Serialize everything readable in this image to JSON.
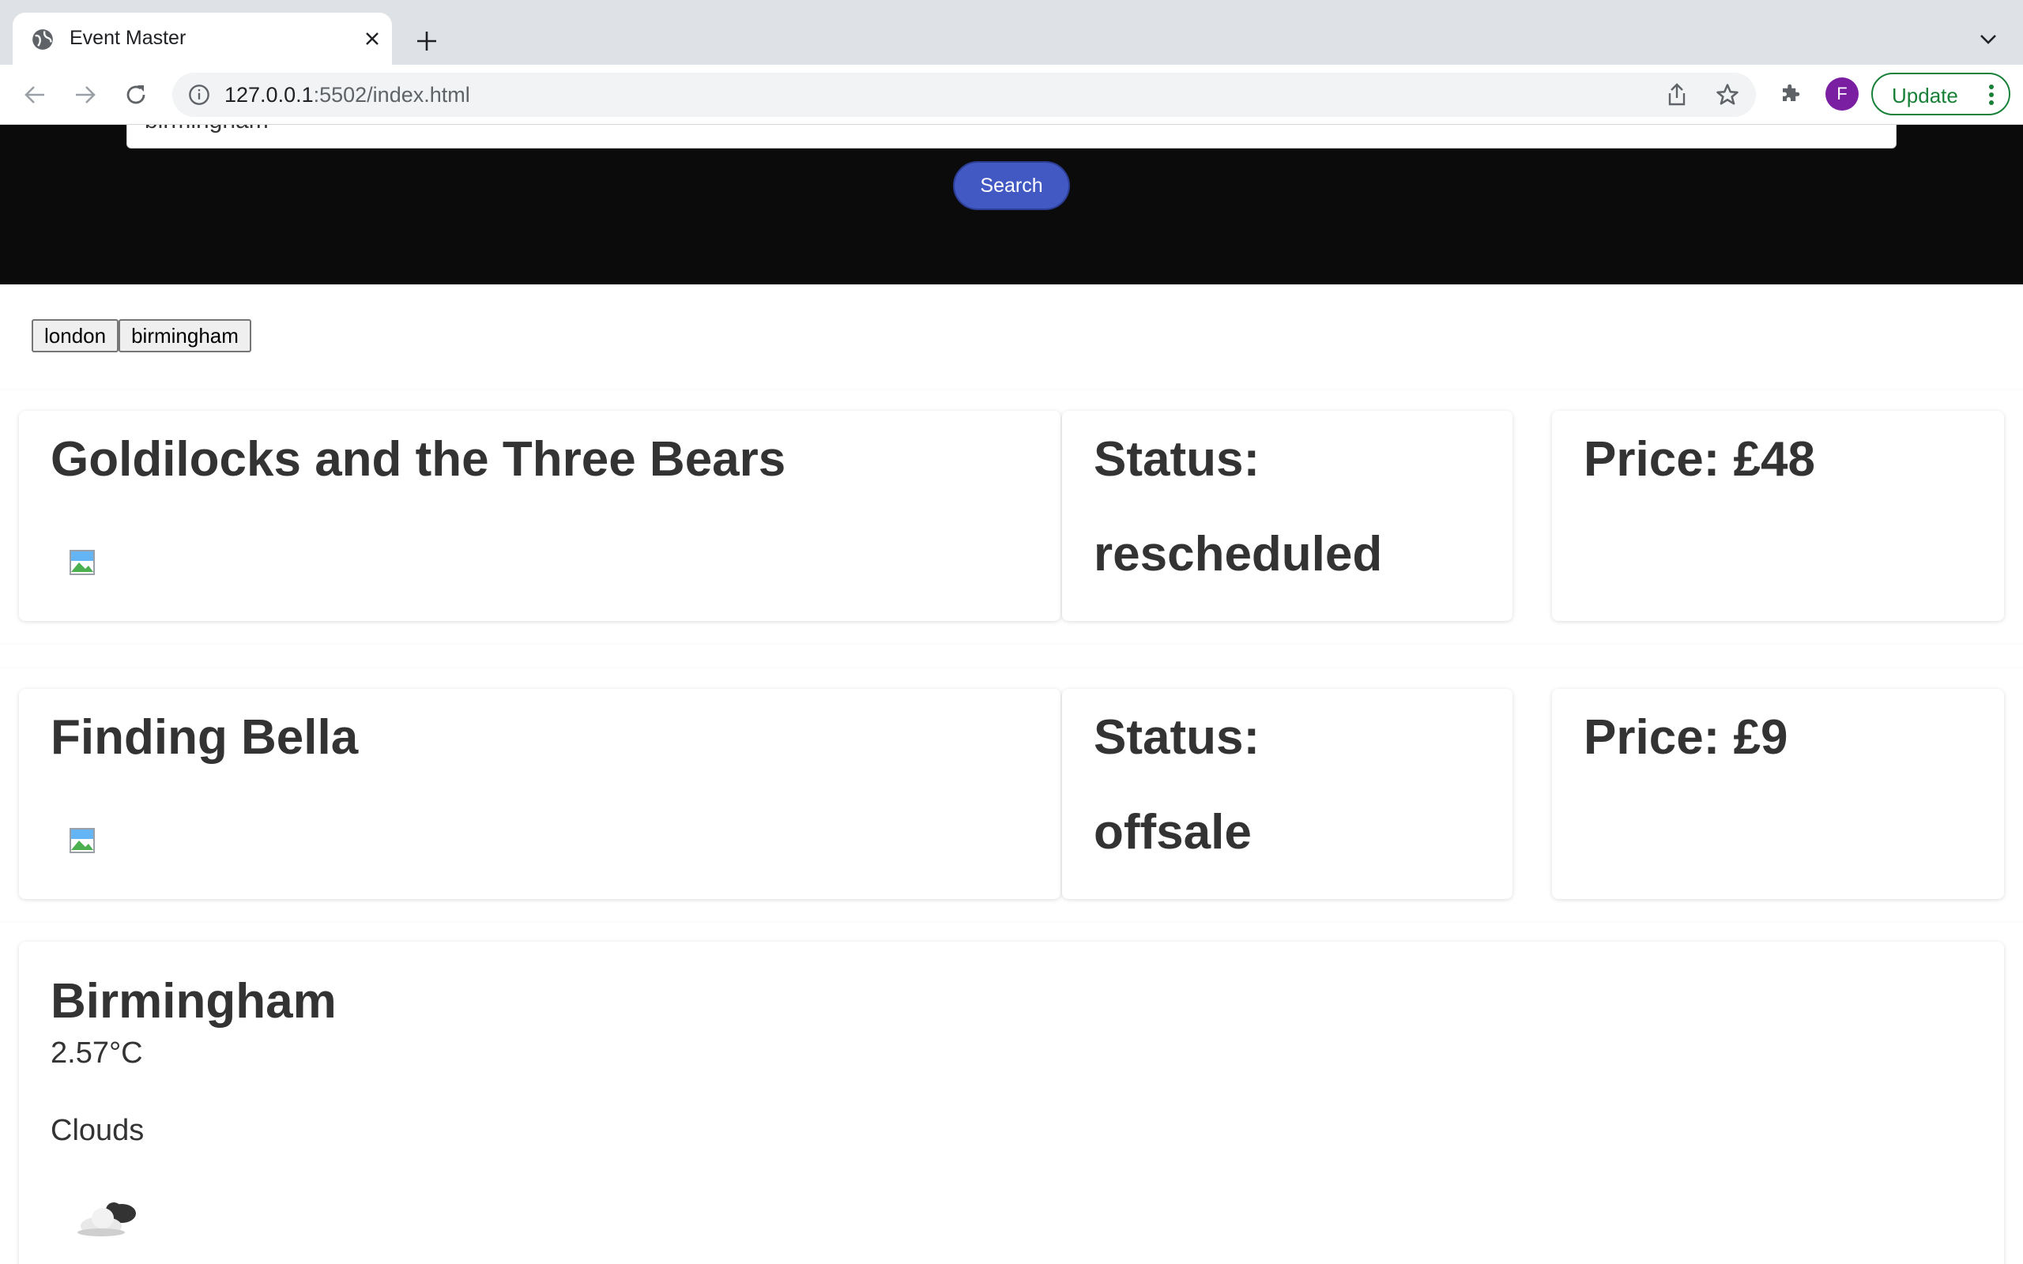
{
  "browser": {
    "tab_title": "Event Master",
    "url_host": "127.0.0.1",
    "url_rest": ":5502/index.html",
    "profile_initial": "F",
    "update_label": "Update"
  },
  "search": {
    "value": "birmingham",
    "button_label": "Search"
  },
  "history": [
    "london",
    "birmingham"
  ],
  "events": [
    {
      "title": "Goldilocks and the Three Bears",
      "status_label": "Status:",
      "status": "rescheduled",
      "price": "Price: £48"
    },
    {
      "title": "Finding Bella",
      "status_label": "Status:",
      "status": "offsale",
      "price": "Price: £9"
    }
  ],
  "weather": {
    "city": "Birmingham",
    "temperature": "2.57°C",
    "description": "Clouds",
    "icon": "clouds-icon"
  },
  "colors": {
    "hero_background": "#0b0b0b",
    "search_button": "#4259c3",
    "update_green": "#188038",
    "avatar_purple": "#7b1fa2"
  }
}
